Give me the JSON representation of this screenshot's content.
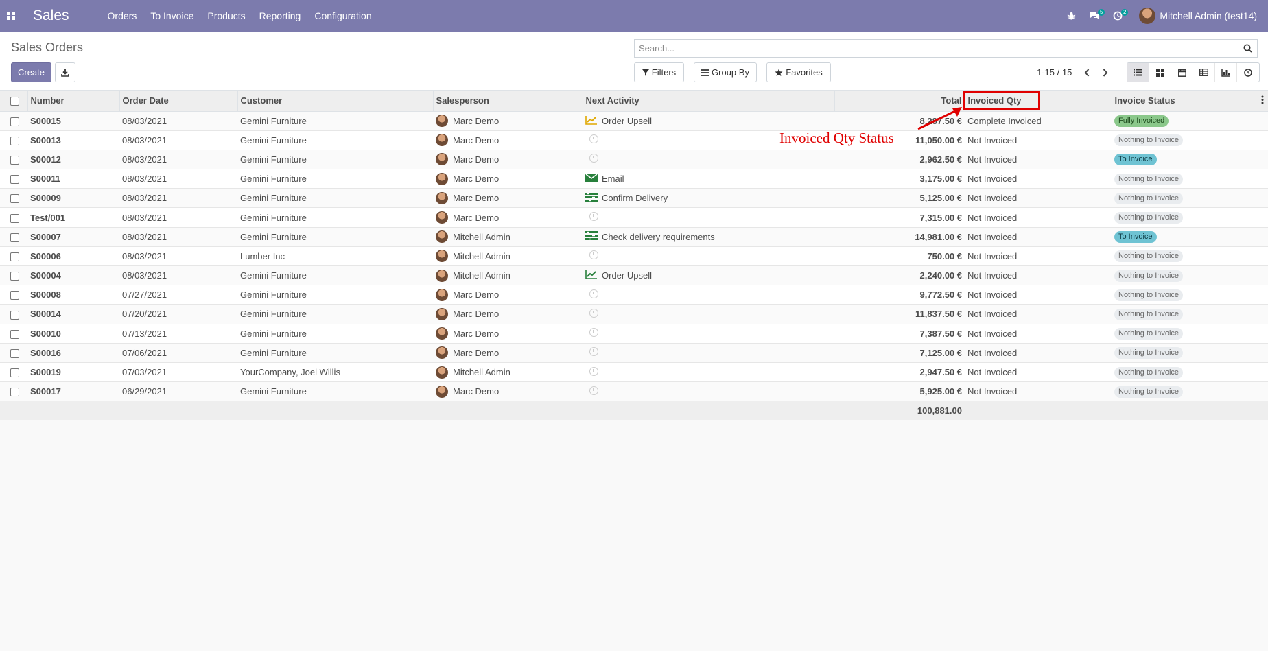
{
  "navbar": {
    "brand": "Sales",
    "menu": [
      "Orders",
      "To Invoice",
      "Products",
      "Reporting",
      "Configuration"
    ],
    "messages_count": "5",
    "activities_count": "2",
    "user": "Mitchell Admin (test14)"
  },
  "control_panel": {
    "title": "Sales Orders",
    "create_label": "Create",
    "search_placeholder": "Search...",
    "filters_label": "Filters",
    "groupby_label": "Group By",
    "favorites_label": "Favorites",
    "pager": "1-15 / 15"
  },
  "table": {
    "columns": [
      "Number",
      "Order Date",
      "Customer",
      "Salesperson",
      "Next Activity",
      "Total",
      "Invoiced Qty",
      "Invoice Status"
    ],
    "rows": [
      {
        "number": "S00015",
        "date": "08/03/2021",
        "customer": "Gemini Furniture",
        "salesperson": "Marc Demo",
        "activity": "Order Upsell",
        "activity_icon": "upsell-chart-icon-yellow",
        "total": "8,287.50 €",
        "invoiced_qty": "Complete Invoiced",
        "status": "Fully Invoiced",
        "status_kind": "full"
      },
      {
        "number": "S00013",
        "date": "08/03/2021",
        "customer": "Gemini Furniture",
        "salesperson": "Marc Demo",
        "activity": "",
        "activity_icon": "clock-icon",
        "total": "11,050.00 €",
        "invoiced_qty": "Not Invoiced",
        "status": "Nothing to Invoice",
        "status_kind": "nothing"
      },
      {
        "number": "S00012",
        "date": "08/03/2021",
        "customer": "Gemini Furniture",
        "salesperson": "Marc Demo",
        "activity": "",
        "activity_icon": "clock-icon",
        "total": "2,962.50 €",
        "invoiced_qty": "Not Invoiced",
        "status": "To Invoice",
        "status_kind": "to"
      },
      {
        "number": "S00011",
        "date": "08/03/2021",
        "customer": "Gemini Furniture",
        "salesperson": "Marc Demo",
        "activity": "Email",
        "activity_icon": "email-icon",
        "total": "3,175.00 €",
        "invoiced_qty": "Not Invoiced",
        "status": "Nothing to Invoice",
        "status_kind": "nothing"
      },
      {
        "number": "S00009",
        "date": "08/03/2021",
        "customer": "Gemini Furniture",
        "salesperson": "Marc Demo",
        "activity": "Confirm Delivery",
        "activity_icon": "tasks-icon",
        "total": "5,125.00 €",
        "invoiced_qty": "Not Invoiced",
        "status": "Nothing to Invoice",
        "status_kind": "nothing"
      },
      {
        "number": "Test/001",
        "date": "08/03/2021",
        "customer": "Gemini Furniture",
        "salesperson": "Marc Demo",
        "activity": "",
        "activity_icon": "clock-icon",
        "total": "7,315.00 €",
        "invoiced_qty": "Not Invoiced",
        "status": "Nothing to Invoice",
        "status_kind": "nothing"
      },
      {
        "number": "S00007",
        "date": "08/03/2021",
        "customer": "Gemini Furniture",
        "salesperson": "Mitchell Admin",
        "activity": "Check delivery requirements",
        "activity_icon": "tasks-icon",
        "total": "14,981.00 €",
        "invoiced_qty": "Not Invoiced",
        "status": "To Invoice",
        "status_kind": "to"
      },
      {
        "number": "S00006",
        "date": "08/03/2021",
        "customer": "Lumber Inc",
        "salesperson": "Mitchell Admin",
        "activity": "",
        "activity_icon": "clock-icon",
        "total": "750.00 €",
        "invoiced_qty": "Not Invoiced",
        "status": "Nothing to Invoice",
        "status_kind": "nothing"
      },
      {
        "number": "S00004",
        "date": "08/03/2021",
        "customer": "Gemini Furniture",
        "salesperson": "Mitchell Admin",
        "activity": "Order Upsell",
        "activity_icon": "upsell-chart-icon-green",
        "total": "2,240.00 €",
        "invoiced_qty": "Not Invoiced",
        "status": "Nothing to Invoice",
        "status_kind": "nothing"
      },
      {
        "number": "S00008",
        "date": "07/27/2021",
        "customer": "Gemini Furniture",
        "salesperson": "Marc Demo",
        "activity": "",
        "activity_icon": "clock-icon",
        "total": "9,772.50 €",
        "invoiced_qty": "Not Invoiced",
        "status": "Nothing to Invoice",
        "status_kind": "nothing"
      },
      {
        "number": "S00014",
        "date": "07/20/2021",
        "customer": "Gemini Furniture",
        "salesperson": "Marc Demo",
        "activity": "",
        "activity_icon": "clock-icon",
        "total": "11,837.50 €",
        "invoiced_qty": "Not Invoiced",
        "status": "Nothing to Invoice",
        "status_kind": "nothing"
      },
      {
        "number": "S00010",
        "date": "07/13/2021",
        "customer": "Gemini Furniture",
        "salesperson": "Marc Demo",
        "activity": "",
        "activity_icon": "clock-icon",
        "total": "7,387.50 €",
        "invoiced_qty": "Not Invoiced",
        "status": "Nothing to Invoice",
        "status_kind": "nothing"
      },
      {
        "number": "S00016",
        "date": "07/06/2021",
        "customer": "Gemini Furniture",
        "salesperson": "Marc Demo",
        "activity": "",
        "activity_icon": "clock-icon",
        "total": "7,125.00 €",
        "invoiced_qty": "Not Invoiced",
        "status": "Nothing to Invoice",
        "status_kind": "nothing"
      },
      {
        "number": "S00019",
        "date": "07/03/2021",
        "customer": "YourCompany, Joel Willis",
        "salesperson": "Mitchell Admin",
        "activity": "",
        "activity_icon": "clock-icon",
        "total": "2,947.50 €",
        "invoiced_qty": "Not Invoiced",
        "status": "Nothing to Invoice",
        "status_kind": "nothing"
      },
      {
        "number": "S00017",
        "date": "06/29/2021",
        "customer": "Gemini Furniture",
        "salesperson": "Marc Demo",
        "activity": "",
        "activity_icon": "clock-icon",
        "total": "5,925.00 €",
        "invoiced_qty": "Not Invoiced",
        "status": "Nothing to Invoice",
        "status_kind": "nothing"
      }
    ],
    "grand_total": "100,881.00"
  },
  "annotation": {
    "text": "Invoiced Qty Status",
    "color": "#e00000"
  },
  "colors": {
    "brand": "#7c7bad",
    "pill_full": "#8bc88b",
    "pill_to_invoice": "#6fc3d3",
    "pill_nothing": "#e9ecef"
  }
}
